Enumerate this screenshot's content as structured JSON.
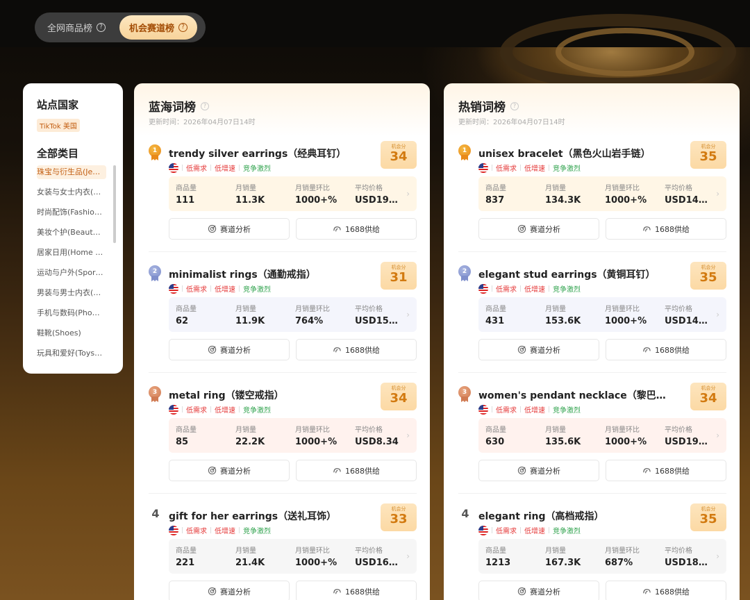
{
  "tabs": [
    {
      "label": "全网商品榜"
    },
    {
      "label": "机会赛道榜"
    }
  ],
  "sidebar": {
    "site_title": "站点国家",
    "site": "TikTok 美国",
    "category_title": "全部类目",
    "categories": [
      "珠宝与衍生品(Je…",
      "女装与女士内衣(…",
      "时尚配饰(Fashio…",
      "美妆个护(Beauty …",
      "居家日用(Home …",
      "运动与户外(Sport…",
      "男装与男士内衣(…",
      "手机与数码(Phon…",
      "鞋靴(Shoes)",
      "玩具和爱好(Toys …"
    ]
  },
  "labels": {
    "score": "机会分",
    "qty": "商品量",
    "monthly": "月销量",
    "mom": "月销量环比",
    "avg": "平均价格",
    "analysis": "赛道分析",
    "supply": "1688供给",
    "low_demand": "低需求",
    "low_growth": "低增速",
    "competition": "竞争激烈"
  },
  "panels": [
    {
      "title": "蓝海词榜",
      "updated": "更新时间：2026年04月07日14时",
      "items": [
        {
          "rank": "1",
          "keyword": "trendy silver earrings（经典耳钉）",
          "score": "34",
          "qty": "111",
          "monthly": "11.3K",
          "mom": "1000+%",
          "avg": "USD19.…"
        },
        {
          "rank": "2",
          "keyword": "minimalist rings（通勤戒指）",
          "score": "31",
          "qty": "62",
          "monthly": "11.9K",
          "mom": "764%",
          "avg": "USD15.…"
        },
        {
          "rank": "3",
          "keyword": "metal ring（镂空戒指）",
          "score": "34",
          "qty": "85",
          "monthly": "22.2K",
          "mom": "1000+%",
          "avg": "USD8.34"
        },
        {
          "rank": "4",
          "keyword": "gift for her earrings（送礼耳饰）",
          "score": "33",
          "qty": "221",
          "monthly": "21.4K",
          "mom": "1000+%",
          "avg": "USD16.…"
        }
      ]
    },
    {
      "title": "热销词榜",
      "updated": "更新时间：2026年04月07日14时",
      "items": [
        {
          "rank": "1",
          "keyword": "unisex bracelet（黑色火山岩手链）",
          "score": "35",
          "qty": "837",
          "monthly": "134.3K",
          "mom": "1000+%",
          "avg": "USD14.…"
        },
        {
          "rank": "2",
          "keyword": "elegant stud earrings（黄铜耳钉）",
          "score": "35",
          "qty": "431",
          "monthly": "153.6K",
          "mom": "1000+%",
          "avg": "USD14.…"
        },
        {
          "rank": "3",
          "keyword": "women's pendant necklace（黎巴嫩地…",
          "score": "34",
          "qty": "630",
          "monthly": "135.6K",
          "mom": "1000+%",
          "avg": "USD19.…"
        },
        {
          "rank": "4",
          "keyword": "elegant ring（高档戒指）",
          "score": "35",
          "qty": "1213",
          "monthly": "167.3K",
          "mom": "687%",
          "avg": "USD18.…"
        }
      ]
    }
  ],
  "colors": {
    "accent": "#d27a10",
    "red": "#e53a3a",
    "green": "#2ea24c"
  }
}
